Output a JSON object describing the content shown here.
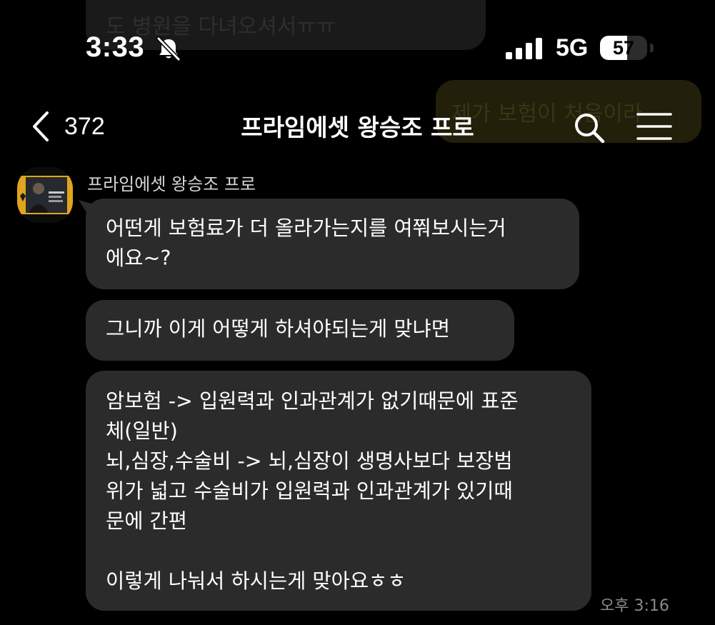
{
  "background_overlay": {
    "top_text": "도 병원을 다녀오셔서ㅠㅠ",
    "right_text": "제가 보험이 처음이라"
  },
  "status_bar": {
    "time": "3:33",
    "network": "5G",
    "battery": "57",
    "battery_level": 0.57
  },
  "header": {
    "back_count": "372",
    "title": "프라임에셋 왕승조 프로"
  },
  "message_group": {
    "sender_name": "프라임에셋 왕승조 프로",
    "messages": [
      {
        "lines": [
          "어떤게 보험료가 더 올라가는지를 여쭤보시는거",
          "에요~?"
        ]
      },
      {
        "lines": [
          "그니까 이게 어떻게 하셔야되는게 맞냐면"
        ]
      },
      {
        "lines": [
          "암보험 -> 입원력과 인과관계가 없기때문에 표준",
          "체(일반)",
          "뇌,심장,수술비 -> 뇌,심장이 생명사보다 보장범",
          "위가 넓고 수술비가 입원력과 인과관계가 있기때",
          "문에 간편",
          "",
          "이렇게 나눠서 하시는게 맞아요ㅎㅎ"
        ]
      }
    ],
    "timestamp": "오후 3:16"
  },
  "colors": {
    "background": "#000000",
    "bubble": "#2b2b2b",
    "text": "#ffffff",
    "timestamp": "#8a8a8a"
  },
  "icons": [
    "bell-slash-icon",
    "signal-bars-icon",
    "chevron-left-icon",
    "search-icon",
    "hamburger-menu-icon"
  ]
}
